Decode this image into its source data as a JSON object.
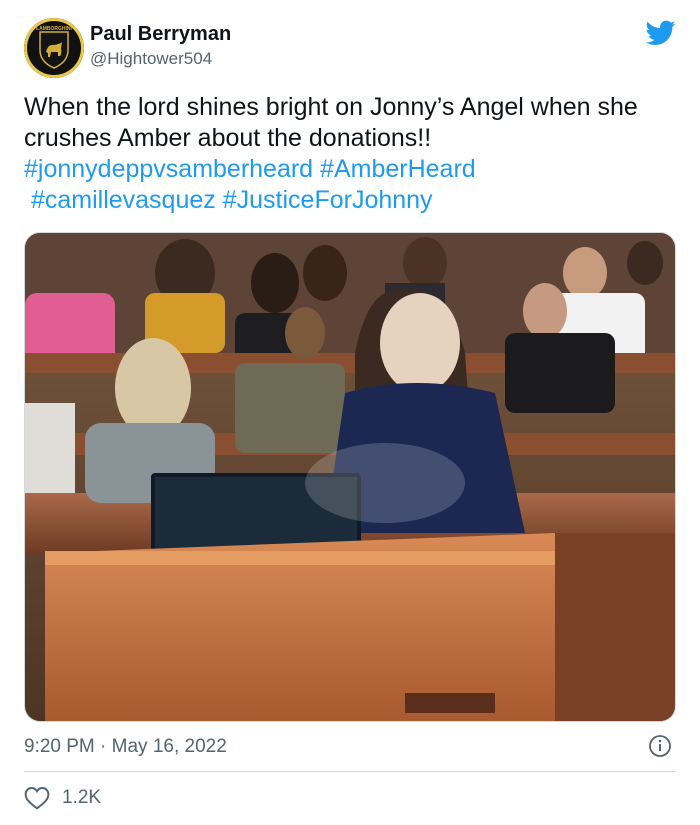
{
  "author": {
    "display_name": "Paul Berryman",
    "handle": "@Hightower504",
    "avatar_icon": "lamborghini-logo-avatar",
    "avatar_text": "LAMBORGHINI"
  },
  "tweet": {
    "text": "When the lord shines bright on Jonny’s Angel when she crushes Amber about the donations!!",
    "hashtags": [
      "#jonnydeppvsamberheard",
      "#AmberHeard",
      "#camillevasquez",
      "#JusticeForJohnny"
    ]
  },
  "media": {
    "icon": "courtroom-photo"
  },
  "meta": {
    "time": "9:20 PM",
    "separator": "·",
    "date": "May 16, 2022"
  },
  "actions": {
    "like_count": "1.2K"
  },
  "colors": {
    "accent": "#1d9bf0",
    "text": "#0f1419",
    "muted": "#536471",
    "border": "#cfd9de"
  }
}
